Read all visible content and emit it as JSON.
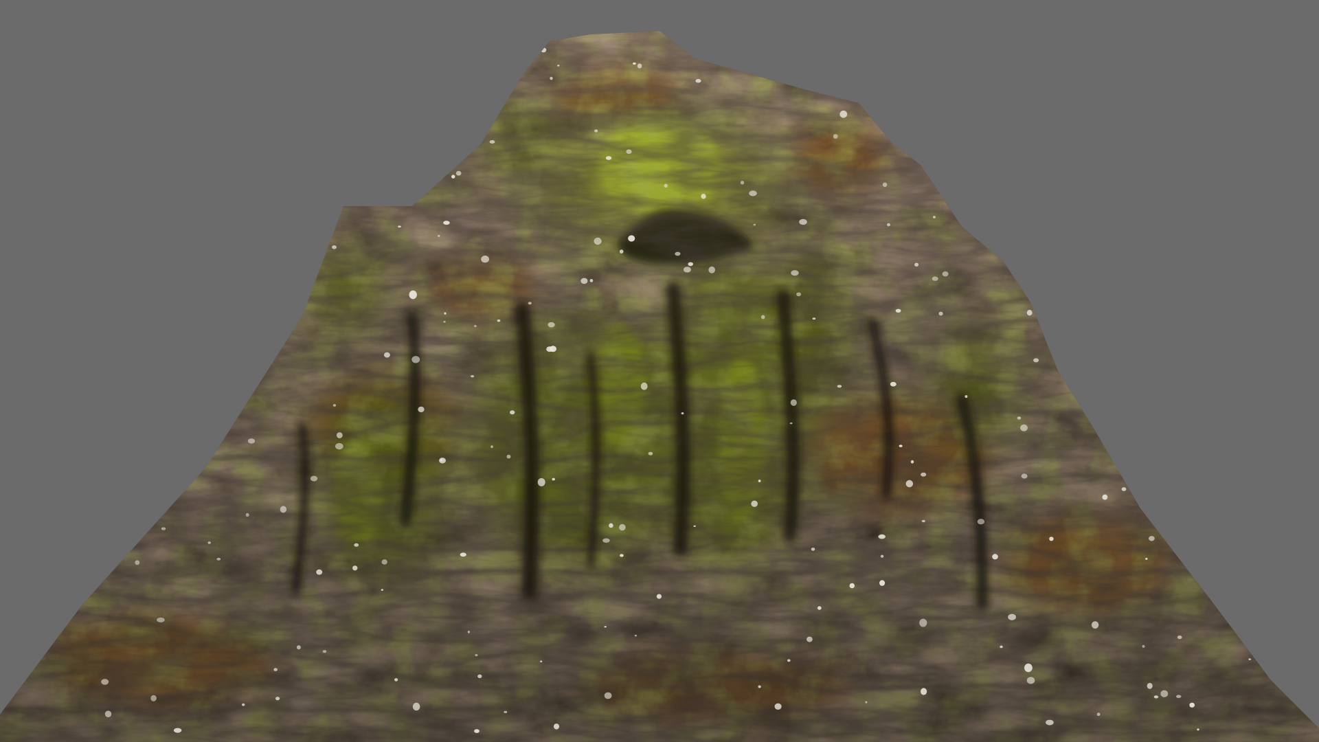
{
  "scene": {
    "subject": "mossy-rock-volcano-mound",
    "background_color": "#6b6b6b",
    "colors": {
      "rock_dark": "#2e2620",
      "rock_mid": "#4a3a2c",
      "rust": "#8a5a22",
      "moss_bright": "#a8b830",
      "moss_mid": "#6e7a1e",
      "moss_dark": "#3d4412",
      "lichen": "#e8e6dc"
    }
  }
}
